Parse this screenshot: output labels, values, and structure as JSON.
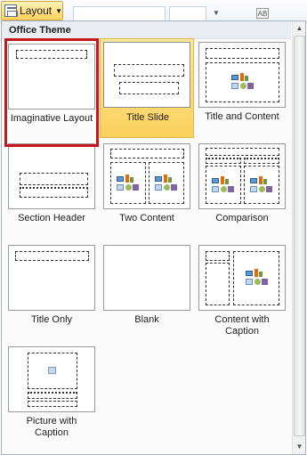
{
  "ribbon": {
    "layout_label": "Layout",
    "layout_icon": "slide-layout-icon",
    "dropdown_icon": "chevron-down-icon",
    "small_button_label": "AB"
  },
  "panel": {
    "header": "Office Theme",
    "layouts": [
      {
        "label": "Imaginative Layout",
        "state": "focused"
      },
      {
        "label": "Title Slide",
        "state": "selected"
      },
      {
        "label": "Title and Content",
        "state": "normal"
      },
      {
        "label": "Section Header",
        "state": "normal"
      },
      {
        "label": "Two Content",
        "state": "normal"
      },
      {
        "label": "Comparison",
        "state": "normal"
      },
      {
        "label": "Title Only",
        "state": "normal"
      },
      {
        "label": "Blank",
        "state": "normal"
      },
      {
        "label": "Content with\nCaption",
        "state": "normal"
      },
      {
        "label": "Picture with\nCaption",
        "state": "normal"
      }
    ]
  },
  "colors": {
    "selected_background": "#fbd15e",
    "focus_outline": "#c8161e",
    "panel_border": "#a6b3c6"
  }
}
